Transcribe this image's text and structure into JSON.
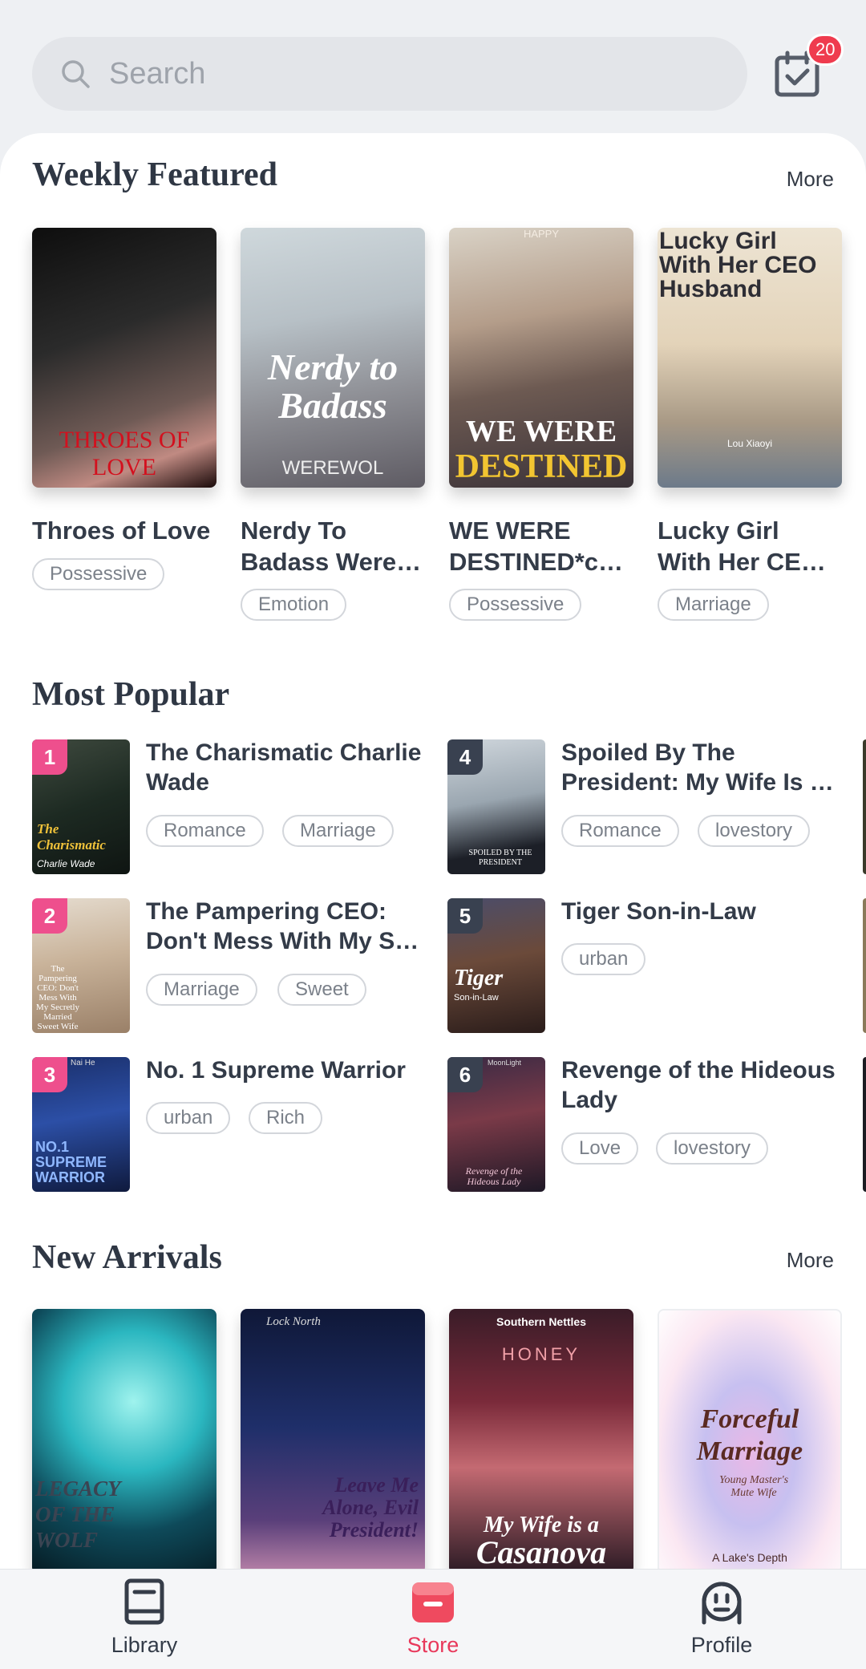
{
  "search": {
    "placeholder": "Search"
  },
  "checkin": {
    "badge": "20"
  },
  "weekly": {
    "title": "Weekly Featured",
    "more": "More",
    "books": [
      {
        "title": "Throes of Love",
        "cover_text": "THROES OF LOVE",
        "tag": "Possessive"
      },
      {
        "title_l1": "Nerdy To",
        "title_l2": "Badass Were…",
        "cover_text": "Nerdy to Badass",
        "cover_sub": "WEREWOL",
        "tag": "Emotion"
      },
      {
        "title_l1": "WE WERE",
        "title_l2": "DESTINED*co…",
        "cover_small": "HAPPY",
        "cover_text": "WE WERE",
        "cover_text2": "DESTINED",
        "tag": "Possessive"
      },
      {
        "title_l1": "Lucky Girl",
        "title_l2": "With Her CEO…",
        "cover_text": "Lucky Girl With Her CEO Husband",
        "cover_sub": "Lou Xiaoyi",
        "tag": "Marriage"
      }
    ]
  },
  "popular": {
    "title": "Most Popular",
    "items": [
      {
        "rank": "1",
        "title_l1": "The Charismatic Charlie",
        "title_l2": "Wade",
        "cover_text": "The Charismatic",
        "cover_sub": "Charlie Wade",
        "tags": [
          "Romance",
          "Marriage"
        ]
      },
      {
        "rank": "2",
        "title_l1": "The Pampering CEO:",
        "title_l2": "Don't Mess With My Se…",
        "cover_text": "The Pampering CEO: Don't Mess With My Secretly Married Sweet Wife",
        "tags": [
          "Marriage",
          "Sweet"
        ]
      },
      {
        "rank": "3",
        "title_l1": "No. 1 Supreme Warrior",
        "title_l2": "",
        "cover_small": "Nai He",
        "cover_text": "NO.1 SUPREME WARRIOR",
        "tags": [
          "urban",
          "Rich"
        ]
      },
      {
        "rank": "4",
        "title_l1": "Spoiled By The",
        "title_l2": "President: My Wife Is …",
        "cover_text": "SPOILED BY THE PRESIDENT",
        "tags": [
          "Romance",
          "lovestory"
        ]
      },
      {
        "rank": "5",
        "title_l1": "Tiger Son-in-Law",
        "title_l2": "",
        "cover_text": "Tiger",
        "cover_sub": "Son-in-Law",
        "tags": [
          "urban"
        ]
      },
      {
        "rank": "6",
        "title_l1": "Revenge of the Hideous",
        "title_l2": "Lady",
        "cover_small": "MoonLight",
        "cover_text": "Revenge of the Hideous Lady",
        "tags": [
          "Love",
          "lovestory"
        ]
      }
    ]
  },
  "arrivals": {
    "title": "New Arrivals",
    "more": "More",
    "books": [
      {
        "cover_text": "LEGACY OF THE WOLF"
      },
      {
        "cover_small": "Lock North",
        "cover_text": "Leave Me Alone, Evil President!"
      },
      {
        "cover_small": "Southern Nettles",
        "cover_mid": "HONEY",
        "cover_text": "My Wife is a",
        "cover_text2": "Casanova"
      },
      {
        "cover_text": "Forceful Marriage",
        "cover_mid": "Young Master's Mute Wife",
        "cover_small": "A Lake's Depth"
      }
    ]
  },
  "nav": {
    "library": "Library",
    "store": "Store",
    "profile": "Profile"
  },
  "colors": {
    "accent": "#e8385b",
    "badge": "#ef3b4e",
    "rank_top": "#ee4f8d",
    "rank_other": "#394150"
  }
}
